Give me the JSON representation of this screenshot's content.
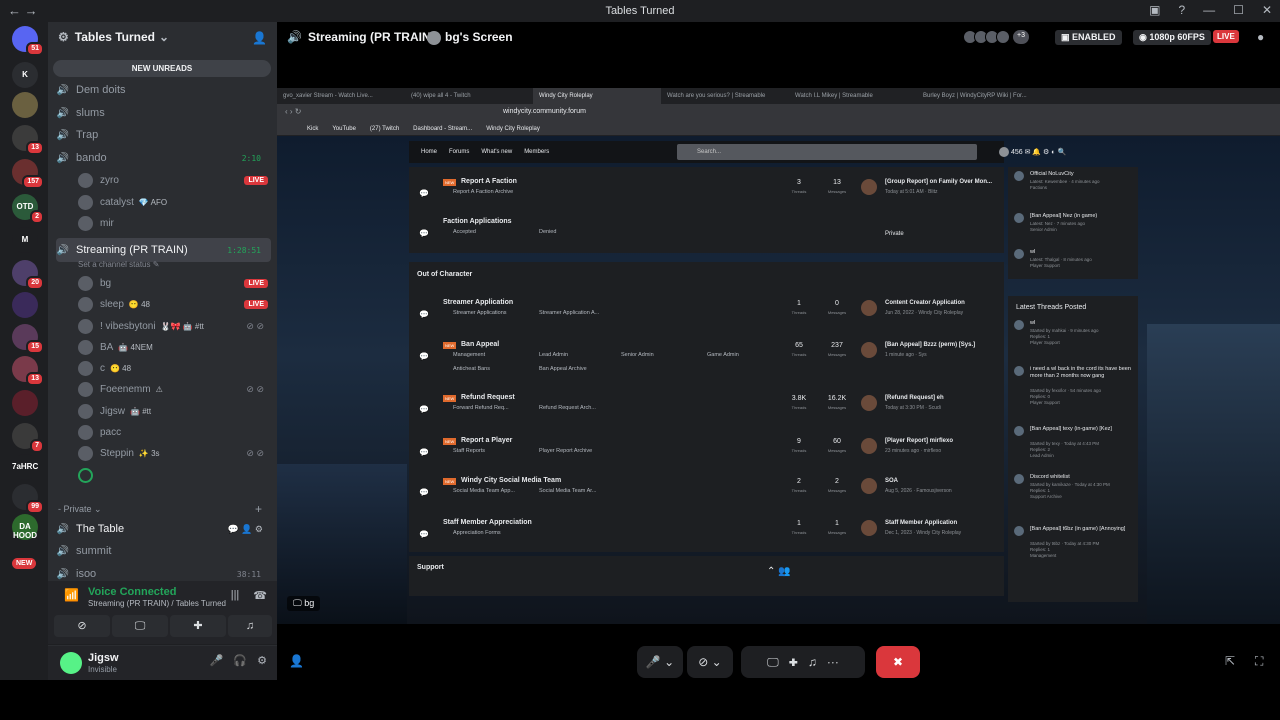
{
  "titlebar": {
    "title": "Tables Turned"
  },
  "guilds": {
    "items": [
      {
        "label": "",
        "badge": "51"
      },
      {
        "label": "K",
        "badge": ""
      },
      {
        "label": "",
        "badge": ""
      },
      {
        "label": "",
        "badge": "13"
      },
      {
        "label": "",
        "badge": "157"
      },
      {
        "label": "OTD",
        "badge": "2"
      },
      {
        "label": "M",
        "badge": ""
      },
      {
        "label": "",
        "badge": "20"
      },
      {
        "label": "",
        "badge": ""
      },
      {
        "label": "",
        "badge": "15"
      },
      {
        "label": "",
        "badge": "13"
      },
      {
        "label": "",
        "badge": ""
      },
      {
        "label": "",
        "badge": "7"
      },
      {
        "label": "7aHRC",
        "badge": ""
      },
      {
        "label": "",
        "badge": "99"
      },
      {
        "label": "DA HOOD",
        "badge": ""
      }
    ],
    "new_badge": "NEW"
  },
  "server": {
    "name": "Tables Turned",
    "new_unreads": "NEW UNREADS"
  },
  "channels": [
    {
      "name": "Dem doits",
      "timer": ""
    },
    {
      "name": "slums",
      "timer": ""
    },
    {
      "name": "Trap",
      "timer": ""
    },
    {
      "name": "bando",
      "timer": "2:10"
    }
  ],
  "bando_users": [
    {
      "name": "zyro",
      "extra": "",
      "live": "LIVE"
    },
    {
      "name": "catalyst",
      "extra": "💎 AFO",
      "live": ""
    },
    {
      "name": "mir",
      "extra": "",
      "live": ""
    }
  ],
  "streaming_channel": {
    "name": "Streaming (PR TRAIN)",
    "timer": "1:28:51",
    "status": "Set a channel status ✎"
  },
  "stream_users": [
    {
      "name": "bg",
      "extra": "",
      "live": "LIVE"
    },
    {
      "name": "sleep",
      "extra": "😶 48",
      "live": "LIVE"
    },
    {
      "name": "! vibesbytoni",
      "extra": "🐰🎀 🤖 #tt",
      "live": ""
    },
    {
      "name": "BA",
      "extra": "🤖 4NEM",
      "live": ""
    },
    {
      "name": "c",
      "extra": "😶 48",
      "live": ""
    },
    {
      "name": "Foeenemm",
      "extra": "⚠",
      "live": ""
    },
    {
      "name": "Jigsw",
      "extra": "🤖 #tt",
      "live": ""
    },
    {
      "name": "pacc",
      "extra": "",
      "live": ""
    },
    {
      "name": "Steppin",
      "extra": "✨ 3s",
      "live": ""
    }
  ],
  "private_category": "Private",
  "private_channels": [
    {
      "name": "The Table",
      "timer": ""
    },
    {
      "name": "summit",
      "timer": ""
    },
    {
      "name": "isoo",
      "timer": "38:11"
    }
  ],
  "voice": {
    "connected": "Voice Connected",
    "sub": "Streaming (PR TRAIN) / Tables Turned"
  },
  "user": {
    "name": "Jigsw",
    "status": "Invisible"
  },
  "stage": {
    "channel": "Streaming (PR TRAIN)",
    "screen": "bg's Screen",
    "viewers_more": "+3",
    "enabled": "ENABLED",
    "quality": "1080p 60FPS",
    "live": "LIVE",
    "overlay_name": "bg"
  },
  "browser": {
    "tabs": [
      "gvo_xavier Stream - Watch Live...",
      "(40) wipe all 4 - Twitch",
      "Windy City Roleplay",
      "Watch are you serious? | Streamable",
      "Watch I.L Mikey | Streamable",
      "Burley Boyz | WindyCityRP Wiki | For..."
    ],
    "url": "windycity.community.forum",
    "bookmarks": [
      "Kick",
      "YouTube",
      "(27) Twitch",
      "Dashboard - Stream...",
      "Windy City Roleplay"
    ]
  },
  "forum": {
    "nav": [
      "Home",
      "Forums",
      "What's new",
      "Members"
    ],
    "search": "Search...",
    "user_count": "456",
    "top_rows": [
      {
        "title": "Report A Faction",
        "new": "NEW",
        "sub": [
          "Report A Faction Archive"
        ],
        "threads": "3",
        "messages": "13",
        "last_title": "[Group Report] on Family Over Mon...",
        "last_sub": "Today at 5:01 AM · Blitz"
      },
      {
        "title": "Faction Applications",
        "new": "",
        "sub": [
          "Accepted",
          "Denied"
        ],
        "threads": "",
        "messages": "",
        "last_title": "Private",
        "last_sub": ""
      }
    ],
    "ooc_header": "Out of Character",
    "ooc_rows": [
      {
        "title": "Streamer Application",
        "new": "",
        "sub": [
          "Streamer Applications",
          "Streamer Application A..."
        ],
        "sub2": [],
        "threads": "1",
        "messages": "0",
        "last_title": "Content Creator Application",
        "last_sub": "Jun 28, 2022 · Windy City Roleplay"
      },
      {
        "title": "Ban Appeal",
        "new": "NEW",
        "sub": [
          "Management",
          "Lead Admin",
          "Senior Admin",
          "Game Admin"
        ],
        "sub2": [
          "Anticheat Bans",
          "Ban Appeal Archive"
        ],
        "threads": "65",
        "messages": "237",
        "last_title": "[Ban Appeal] Bzzz (perm) [Sys.]",
        "last_sub": "1 minute ago · Sys"
      },
      {
        "title": "Refund Request",
        "new": "NEW",
        "sub": [
          "Forward Refund Req...",
          "Refund Request Arch..."
        ],
        "sub2": [],
        "threads": "3.8K",
        "messages": "16.2K",
        "last_title": "[Refund Request] eh",
        "last_sub": "Today at 3:30 PM · Scudi"
      },
      {
        "title": "Report a Player",
        "new": "NEW",
        "sub": [
          "Staff Reports",
          "Player Report Archive"
        ],
        "sub2": [],
        "threads": "9",
        "messages": "60",
        "last_title": "[Player Report] mirflexo",
        "last_sub": "23 minutes ago · mirflexo"
      },
      {
        "title": "Windy City Social Media Team",
        "new": "NEW",
        "sub": [
          "Social Media Team App...",
          "Social Media Team Ar..."
        ],
        "sub2": [],
        "threads": "2",
        "messages": "2",
        "last_title": "SOA",
        "last_sub": "Aug 5, 2026 · Famousjiverson"
      },
      {
        "title": "Staff Member Appreciation",
        "new": "",
        "sub": [
          "Appreciation Forms"
        ],
        "sub2": [],
        "threads": "1",
        "messages": "1",
        "last_title": "Staff Member Application",
        "last_sub": "Dec 1, 2023 · Windy City Roleplay"
      }
    ],
    "threads_label": "Threads",
    "messages_label": "Messages",
    "support_header": "Support",
    "side_top": [
      {
        "title": "Official NoLuvCity",
        "sub": [
          "Latest: Kewembee · 4 minutes ago",
          "Factions"
        ]
      },
      {
        "title": "[Ban Appeal] Nez (in game)",
        "sub": [
          "Latest: Nez · 7 minutes ago",
          "Senior Admin"
        ]
      },
      {
        "title": "wl",
        "sub": [
          "Latest: Thalgal · 8 minutes ago",
          "Player Support"
        ]
      }
    ],
    "latest_header": "Latest Threads Posted",
    "latest": [
      {
        "title": "wl",
        "sub": [
          "Started by mahkai · 9 minutes ago",
          "Replies: 1",
          "Player Support"
        ]
      },
      {
        "title": "i need a wl back in the cord its have been more than 2 months now gang",
        "sub": [
          "Started by fexx/lor · 54 minutes ago",
          "Replies: 0",
          "Player Support"
        ]
      },
      {
        "title": "[Ban Appeal] texy (in-game) [Kez]",
        "sub": [
          "Started by texy · Today at 4:43 PM",
          "Replies: 2",
          "Lead Admin"
        ]
      },
      {
        "title": "Discord whitelist",
        "sub": [
          "Started by kamikaze · Today at 4:30 PM",
          "Replies: 1",
          "Support Archive"
        ]
      },
      {
        "title": "[Ban Appeal] t6bz (in game) [Annoying]",
        "sub": [
          "Started by t6bz · Today at 4:30 PM",
          "Replies: 1",
          "Management"
        ]
      }
    ]
  },
  "colors": {
    "discord_dark": "#1e1f22",
    "channel_bg": "#2b2d31",
    "green": "#23a55a",
    "red": "#da373c",
    "forum_new": "#e06a2d"
  }
}
